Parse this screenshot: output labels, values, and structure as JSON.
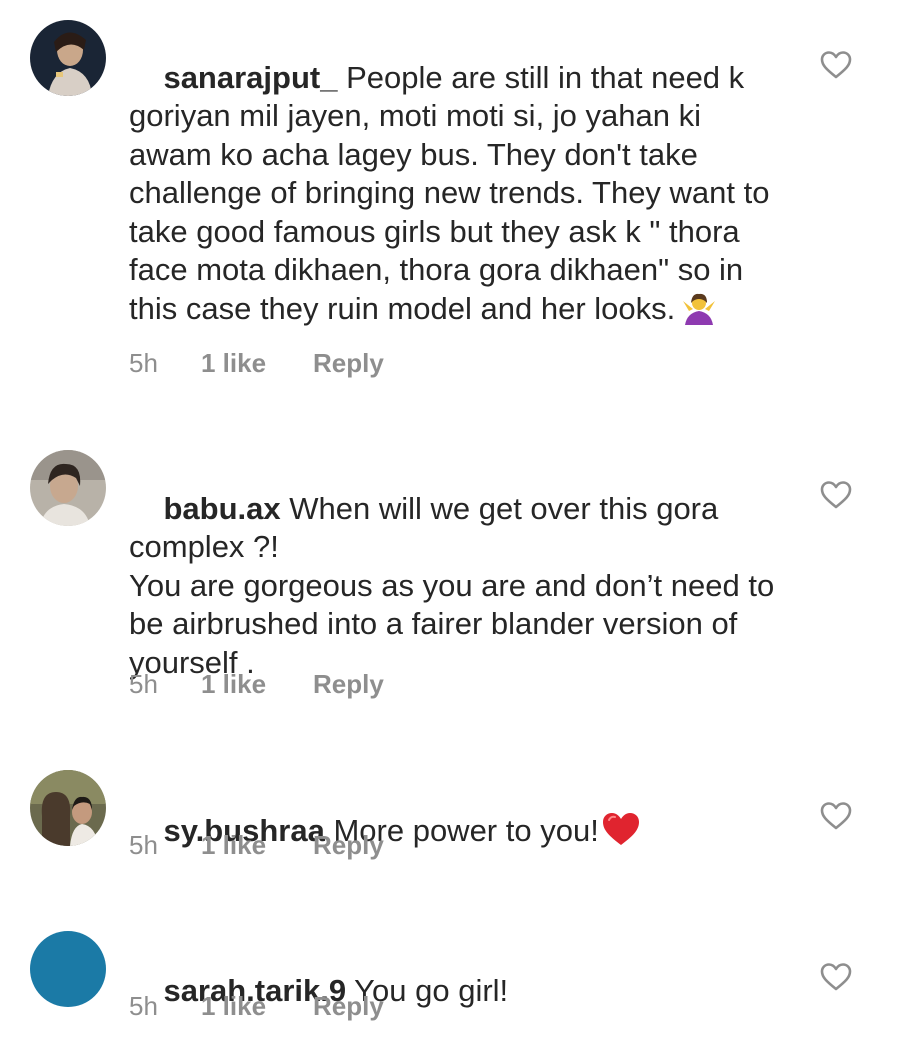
{
  "comments": [
    {
      "username": "sanarajput_",
      "text": " People are still in that need k goriyan mil jayen, moti moti si, jo yahan ki awam ko acha lagey bus. They don't take challenge of bringing new trends. They want to take good famous girls but they ask k \" thora face mota dikhaen, thora gora dikhaen\" so in this case they ruin model and her looks.",
      "emoji": "person-shrugging",
      "time": "5h",
      "likes": "1 like",
      "reply": "Reply",
      "avatar_color": "#1a2535"
    },
    {
      "username": "babu.ax",
      "text": " When will we get over this gora complex ?!\nYou are gorgeous as you are and don’t need to be airbrushed into a fairer blander version of yourself .",
      "time": "5h",
      "likes": "1 like",
      "reply": "Reply",
      "avatar_color": "#9a948c"
    },
    {
      "username": "sy.bushraa",
      "text": " More power to you!",
      "emoji": "red-heart",
      "time": "5h",
      "likes": "1 like",
      "reply": "Reply",
      "avatar_color": "#6b6a4e"
    },
    {
      "username": "sarah.tarik.9",
      "text": " You go girl!",
      "time": "5h",
      "likes": "1 like",
      "reply": "Reply",
      "avatar_color": "#1b7aa6"
    }
  ],
  "colors": {
    "text": "#262626",
    "meta": "#8e8e8e",
    "heart_outline": "#8e8e8e"
  }
}
